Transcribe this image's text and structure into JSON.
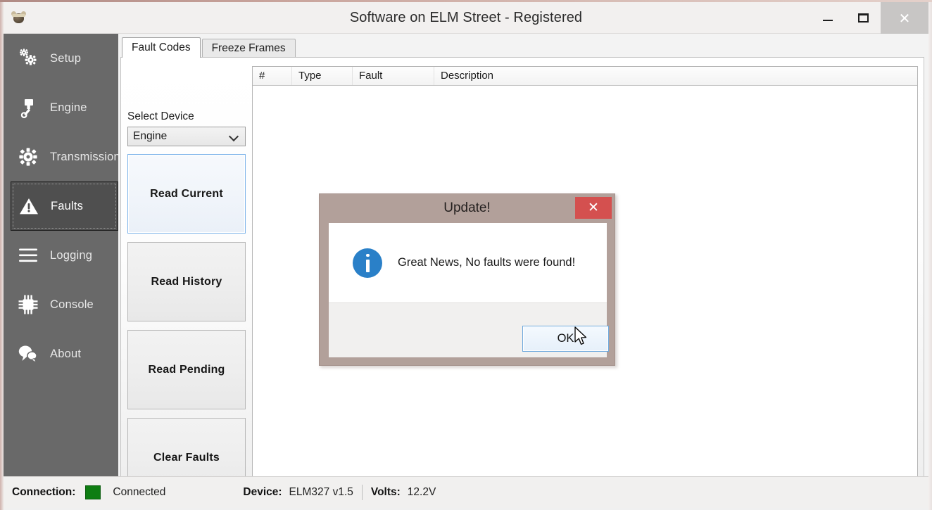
{
  "window": {
    "title": "Software on ELM Street - Registered",
    "icon": "app-bear-icon",
    "controls": {
      "minimize": "minimize-icon",
      "maximize": "maximize-icon",
      "close": "✕"
    }
  },
  "sidebar": {
    "items": [
      {
        "label": "Setup",
        "icon": "gears-icon",
        "selected": false
      },
      {
        "label": "Engine",
        "icon": "engine-piston-icon",
        "selected": false
      },
      {
        "label": "Transmission",
        "icon": "gear-icon",
        "selected": false
      },
      {
        "label": "Faults",
        "icon": "warning-triangle-icon",
        "selected": true
      },
      {
        "label": "Logging",
        "icon": "hamburger-lines-icon",
        "selected": false
      },
      {
        "label": "Console",
        "icon": "chip-icon",
        "selected": false
      },
      {
        "label": "About",
        "icon": "speech-bubbles-icon",
        "selected": false
      }
    ]
  },
  "main": {
    "tabs": [
      {
        "label": "Fault Codes",
        "active": true
      },
      {
        "label": "Freeze Frames",
        "active": false
      }
    ],
    "select_device": {
      "label": "Select Device",
      "value": "Engine",
      "chevron": "chevron-down-icon"
    },
    "buttons": [
      {
        "label": "Read Current",
        "focused": true
      },
      {
        "label": "Read History",
        "focused": false
      },
      {
        "label": "Read Pending",
        "focused": false
      },
      {
        "label": "Clear Faults",
        "focused": false
      }
    ],
    "table": {
      "columns": [
        "#",
        "Type",
        "Fault",
        "Description"
      ],
      "rows": []
    }
  },
  "dialog": {
    "title": "Update!",
    "close_glyph": "✕",
    "icon": "info-icon",
    "message": "Great News, No faults were found!",
    "ok_label": "OK"
  },
  "statusbar": {
    "connection_label": "Connection:",
    "connection_value": "Connected",
    "connection_color": "#0e7d12",
    "device_label": "Device:",
    "device_value": "ELM327 v1.5",
    "volts_label": "Volts:",
    "volts_value": "12.2V"
  }
}
